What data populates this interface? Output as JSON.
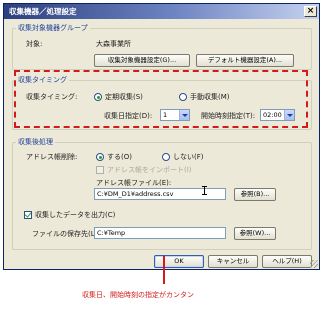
{
  "window": {
    "title": "収集機器／処理設定",
    "close_symbol": "×"
  },
  "target_group": {
    "legend": "収集対象機器グループ",
    "target_label": "対象:",
    "target_value": "大森事業所",
    "settings_button": "収集対象機器設定(G)...",
    "default_button": "デフォルト機器設定(A)..."
  },
  "timing_group": {
    "legend": "収集タイミング",
    "timing_label": "収集タイミング:",
    "periodic_label": "定期収集(S)",
    "manual_label": "手動収集(M)",
    "day_label": "収集日指定(D):",
    "day_value": "1",
    "start_label": "開始時刻指定(T):",
    "start_value": "02:00"
  },
  "post_group": {
    "legend": "収集後処理",
    "address_delete_label": "アドレス帳削除:",
    "yes_label": "する(O)",
    "no_label": "しない(F)",
    "import_label": "アドレス帳をインポート(I)",
    "address_file_label": "アドレス帳ファイル(E):",
    "address_file_value": "C:¥DM_D1¥address.csv",
    "browse_button_1": "参照(B)...",
    "output_label": "収集したデータを出力(C)",
    "save_dir_label": "ファイルの保存先(L):",
    "save_dir_value": "C:¥Temp",
    "browse_button_2": "参照(W)..."
  },
  "footer": {
    "ok": "OK",
    "cancel": "キャンセル",
    "help": "ヘルプ(H)"
  },
  "annotation": {
    "caption": "収集日、開始時刻の指定がカンタン",
    "color": "#d21b1b"
  }
}
